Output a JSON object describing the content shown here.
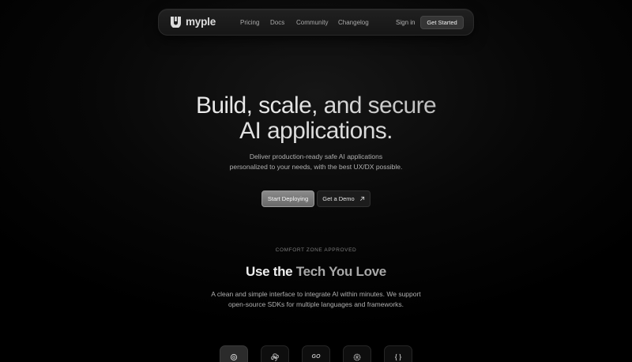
{
  "nav": {
    "brand": "myple",
    "links": [
      "Pricing",
      "Docs",
      "Community",
      "Changelog"
    ],
    "sign_in": "Sign in",
    "cta": "Get Started"
  },
  "hero": {
    "title_line1": "Build, scale, and secure",
    "title_line2": "AI applications.",
    "subtitle_line1": "Deliver production-ready safe AI applications",
    "subtitle_line2": "personalized to your needs, with the best UX/DX possible.",
    "primary_button": "Start Deploying",
    "secondary_button": "Get a Demo"
  },
  "tech_section": {
    "eyebrow": "COMFORT ZONE APPROVED",
    "title_part1": "Use the",
    "title_part2": "Tech You Love",
    "subtitle_line1": "A clean and simple interface to integrate AI within minutes. We support",
    "subtitle_line2": "open-source SDKs for multiple languages and frameworks.",
    "icons": [
      {
        "name": "openai-icon",
        "active": true
      },
      {
        "name": "python-icon",
        "active": false
      },
      {
        "name": "go-icon",
        "label": "GO",
        "active": false
      },
      {
        "name": "rust-icon",
        "active": false
      },
      {
        "name": "json-braces-icon",
        "active": false
      }
    ]
  },
  "colors": {
    "background": "#000000",
    "nav_bg": "#1b1b1b",
    "primary_button": "#7a7a7a",
    "text_muted": "#b0b0b0"
  }
}
